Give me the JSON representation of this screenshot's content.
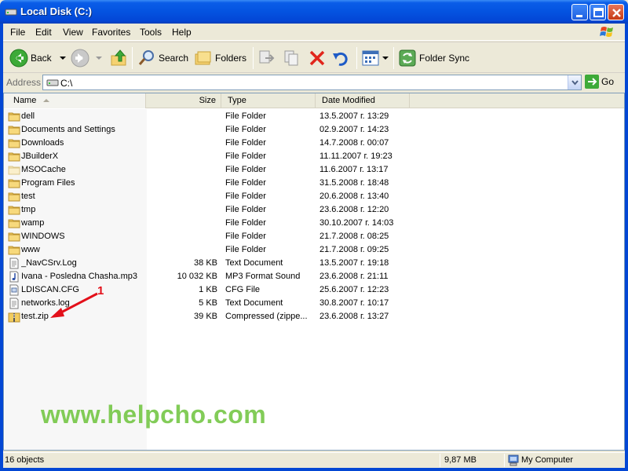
{
  "window": {
    "title": "Local Disk (C:)"
  },
  "menu": [
    "File",
    "Edit",
    "View",
    "Favorites",
    "Tools",
    "Help"
  ],
  "toolbar": {
    "back_label": "Back",
    "search_label": "Search",
    "folders_label": "Folders",
    "folder_sync_label": "Folder Sync"
  },
  "address": {
    "label": "Address",
    "value": "C:\\",
    "go_label": "Go"
  },
  "columns": {
    "name": "Name",
    "size": "Size",
    "type": "Type",
    "date": "Date Modified"
  },
  "files": [
    {
      "name": "dell",
      "size": "",
      "type": "File Folder",
      "date": "13.5.2007 г. 13:29",
      "icon": "folder-icon"
    },
    {
      "name": "Documents and Settings",
      "size": "",
      "type": "File Folder",
      "date": "02.9.2007 г. 14:23",
      "icon": "folder-icon"
    },
    {
      "name": "Downloads",
      "size": "",
      "type": "File Folder",
      "date": "14.7.2008 г. 00:07",
      "icon": "folder-icon"
    },
    {
      "name": "JBuilderX",
      "size": "",
      "type": "File Folder",
      "date": "11.11.2007 г. 19:23",
      "icon": "folder-icon"
    },
    {
      "name": "MSOCache",
      "size": "",
      "type": "File Folder",
      "date": "11.6.2007 г. 13:17",
      "icon": "hidden-folder-icon"
    },
    {
      "name": "Program Files",
      "size": "",
      "type": "File Folder",
      "date": "31.5.2008 г. 18:48",
      "icon": "folder-icon"
    },
    {
      "name": "test",
      "size": "",
      "type": "File Folder",
      "date": "20.6.2008 г. 13:40",
      "icon": "folder-icon"
    },
    {
      "name": "tmp",
      "size": "",
      "type": "File Folder",
      "date": "23.6.2008 г. 12:20",
      "icon": "folder-icon"
    },
    {
      "name": "wamp",
      "size": "",
      "type": "File Folder",
      "date": "30.10.2007 г. 14:03",
      "icon": "folder-icon"
    },
    {
      "name": "WINDOWS",
      "size": "",
      "type": "File Folder",
      "date": "21.7.2008 г. 08:25",
      "icon": "folder-icon"
    },
    {
      "name": "www",
      "size": "",
      "type": "File Folder",
      "date": "21.7.2008 г. 09:25",
      "icon": "folder-icon"
    },
    {
      "name": "_NavCSrv.Log",
      "size": "38 KB",
      "type": "Text Document",
      "date": "13.5.2007 г. 19:18",
      "icon": "text-file-icon"
    },
    {
      "name": "Ivana - Posledna Chasha.mp3",
      "size": "10 032 KB",
      "type": "MP3 Format Sound",
      "date": "23.6.2008 г. 21:11",
      "icon": "audio-file-icon"
    },
    {
      "name": "LDISCAN.CFG",
      "size": "1 KB",
      "type": "CFG File",
      "date": "25.6.2007 г. 12:23",
      "icon": "config-file-icon"
    },
    {
      "name": "networks.log",
      "size": "5 KB",
      "type": "Text Document",
      "date": "30.8.2007 г. 10:17",
      "icon": "text-file-icon"
    },
    {
      "name": "test.zip",
      "size": "39 KB",
      "type": "Compressed (zippe...",
      "date": "23.6.2008 г. 13:27",
      "icon": "zip-file-icon"
    }
  ],
  "annotation": {
    "number": "1"
  },
  "watermark": "www.helpcho.com",
  "status": {
    "objects": "16 objects",
    "size": "9,87 MB",
    "zone": "My Computer"
  },
  "colors": {
    "titlebar": "#0453E0",
    "annotation": "#E3101A",
    "watermark": "#6DC43B"
  }
}
